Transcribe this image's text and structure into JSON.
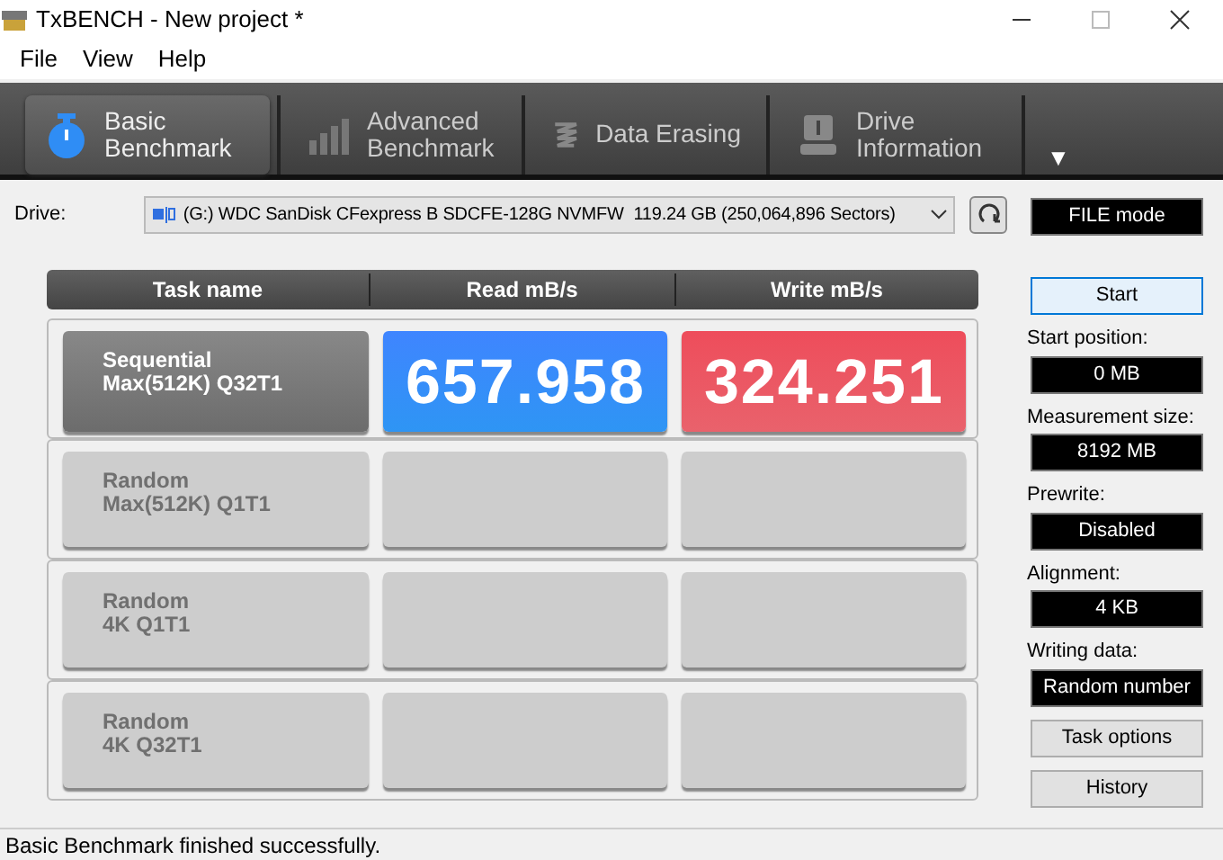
{
  "window": {
    "title": "TxBENCH - New project *"
  },
  "menu": [
    "File",
    "View",
    "Help"
  ],
  "tabs": [
    {
      "label": "Basic\nBenchmark",
      "selected": true
    },
    {
      "label": "Advanced\nBenchmark",
      "selected": false
    },
    {
      "label": "Data Erasing",
      "selected": false
    },
    {
      "label": "Drive\nInformation",
      "selected": false
    }
  ],
  "toolbar_more": "▼",
  "drive": {
    "label": "Drive:",
    "value": "(G:) WDC SanDisk CFexpress B SDCFE-128G NVMFW  119.24 GB (250,064,896 Sectors)"
  },
  "table": {
    "columns": [
      "Task name",
      "Read mB/s",
      "Write mB/s"
    ],
    "rows": [
      {
        "name": [
          "Sequential",
          "Max(512K) Q32T1"
        ],
        "completed": true,
        "read": "657.958",
        "write": "324.251"
      },
      {
        "name": [
          "Random",
          "Max(512K) Q1T1"
        ],
        "completed": false
      },
      {
        "name": [
          "Random",
          "4K Q1T1"
        ],
        "completed": false
      },
      {
        "name": [
          "Random",
          "4K Q32T1"
        ],
        "completed": false
      }
    ]
  },
  "mode": "FILE mode",
  "start_button": {
    "label": "Start",
    "focused": true
  },
  "settings": [
    {
      "label": "Start position:",
      "value": "0 MB"
    },
    {
      "label": "Measurement size:",
      "value": "8192 MB"
    },
    {
      "label": "Prewrite:",
      "value": "Disabled"
    },
    {
      "label": "Alignment:",
      "value": "4 KB"
    },
    {
      "label": "Writing data:",
      "value": "Random number"
    }
  ],
  "buttons": [
    "Task options",
    "History"
  ],
  "status_bar": "Basic Benchmark finished successfully."
}
